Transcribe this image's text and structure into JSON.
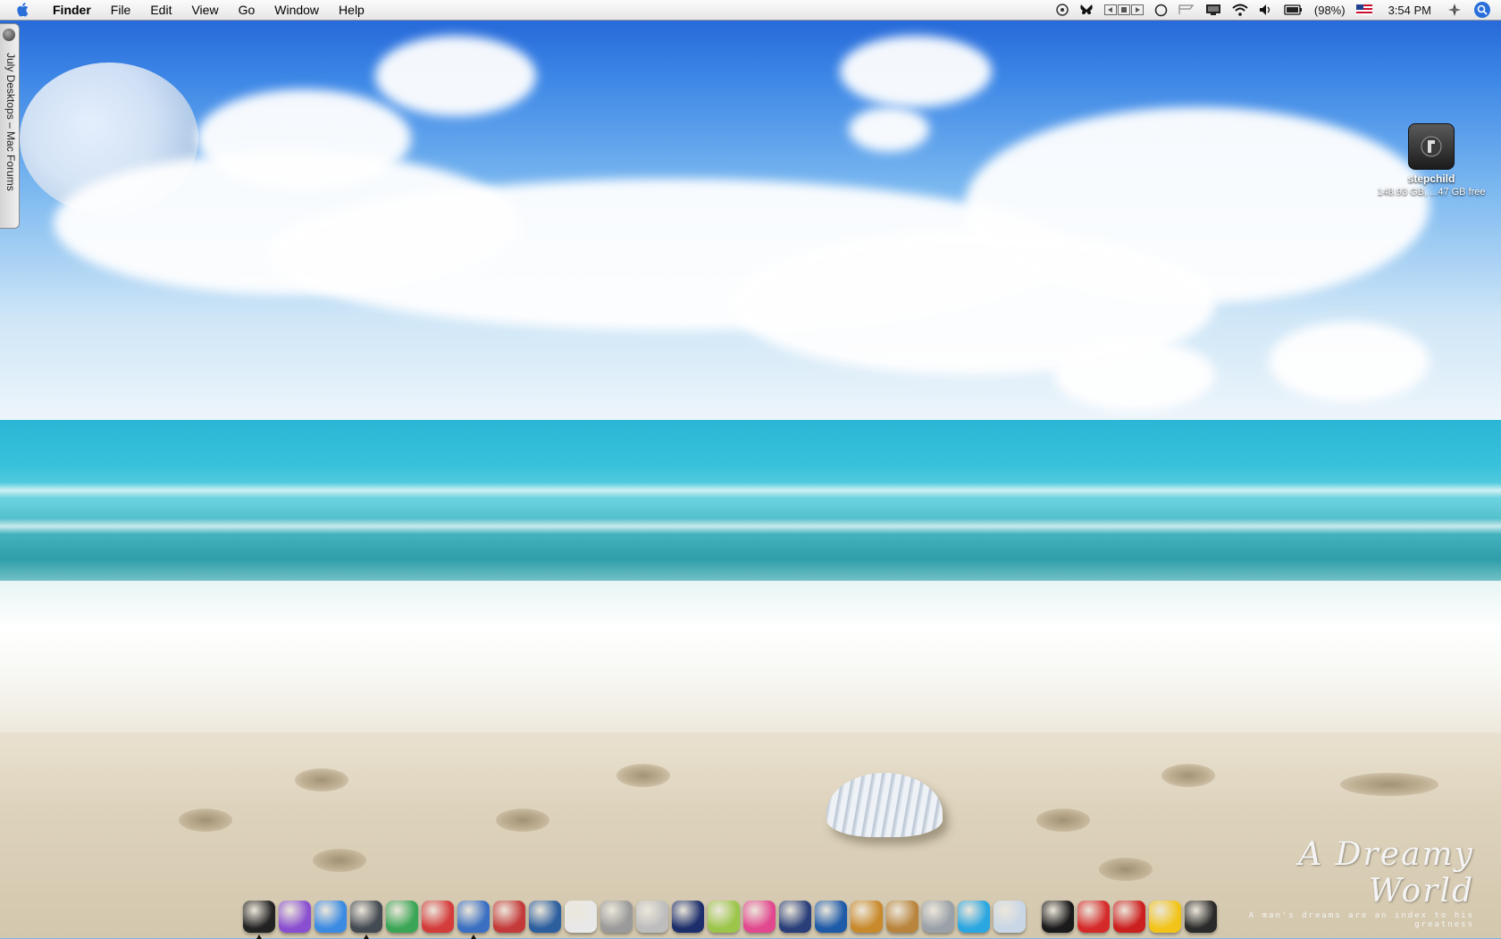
{
  "menubar": {
    "app_name": "Finder",
    "menus": [
      "File",
      "Edit",
      "View",
      "Go",
      "Window",
      "Help"
    ],
    "battery_label": "(98%)",
    "clock": "3:54 PM"
  },
  "drawer": {
    "label": "July Desktops – Mac Forums"
  },
  "desktop": {
    "drive": {
      "name": "stepchild",
      "info": "148.93 GB, ...47 GB free"
    },
    "caption": {
      "title": "A Dreamy World",
      "subtitle": "A man's dreams are an index to his greatness"
    }
  },
  "dock": {
    "items": [
      {
        "icon": "terminal-icon",
        "color": "#222222",
        "running": true
      },
      {
        "icon": "messenger-icon",
        "color": "#8a4fd1",
        "running": false
      },
      {
        "icon": "ichat-icon",
        "color": "#3b8be3",
        "running": false
      },
      {
        "icon": "safari-icon",
        "color": "#444a52",
        "running": true
      },
      {
        "icon": "itunes-icon",
        "color": "#3aa655",
        "running": false
      },
      {
        "icon": "ical-icon",
        "color": "#d43b3b",
        "running": false
      },
      {
        "icon": "preview-icon",
        "color": "#3a6fc2",
        "running": true
      },
      {
        "icon": "no-entry-icon",
        "color": "#c43a3a",
        "running": false
      },
      {
        "icon": "photo-booth-icon",
        "color": "#2c5f9e",
        "running": false
      },
      {
        "icon": "textedit-icon",
        "color": "#e8e8e8",
        "running": false
      },
      {
        "icon": "utility-icon",
        "color": "#9a9a9a",
        "running": false
      },
      {
        "icon": "address-icon",
        "color": "#bdbdbd",
        "running": false
      },
      {
        "icon": "imovie-star-icon",
        "color": "#1c2e6b",
        "running": false
      },
      {
        "icon": "palette-icon",
        "color": "#9cc64a",
        "running": false
      },
      {
        "icon": "flower-icon",
        "color": "#e2488f",
        "running": false
      },
      {
        "icon": "clapper-icon",
        "color": "#2a3f7a",
        "running": false
      },
      {
        "icon": "dvd-player-icon",
        "color": "#1d5aa8",
        "running": false
      },
      {
        "icon": "garageband-icon",
        "color": "#c98a2c",
        "running": false
      },
      {
        "icon": "photo-icon",
        "color": "#b9853d",
        "running": false
      },
      {
        "icon": "system-prefs-icon",
        "color": "#9aa1a8",
        "running": false
      },
      {
        "icon": "skype-icon",
        "color": "#2aa6e0",
        "running": false
      },
      {
        "icon": "ipod-icon",
        "color": "#c8d6e6",
        "running": false
      },
      {
        "icon": "folder-stack-icon",
        "color": "#1a1a1a",
        "running": false
      },
      {
        "icon": "superhero-icon",
        "color": "#d52a2a",
        "running": false
      },
      {
        "icon": "thundercats-icon",
        "color": "#cc1f1f",
        "running": false
      },
      {
        "icon": "batman-icon",
        "color": "#f2c41a",
        "running": false
      },
      {
        "icon": "trash-icon",
        "color": "#2a2a2a",
        "running": false
      }
    ]
  }
}
